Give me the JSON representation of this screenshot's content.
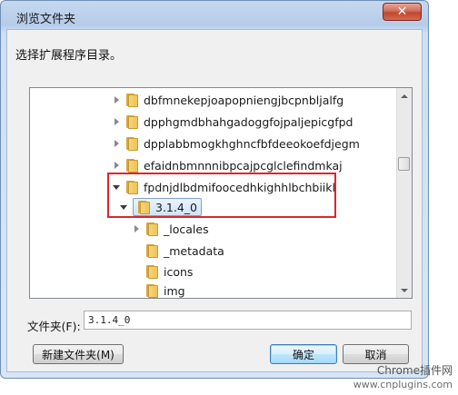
{
  "window": {
    "title": "浏览文件夹"
  },
  "prompt": "选择扩展程序目录。",
  "tree": {
    "items": [
      {
        "label": "dbfmnekepjoapopniengjbcpnbljalfg",
        "state": "collapsed"
      },
      {
        "label": "dpphgmdbhahgadoggfojpaljepicgfpd",
        "state": "collapsed"
      },
      {
        "label": "dpplabbmogkhghncfbfdeeokoefdjegm",
        "state": "collapsed"
      },
      {
        "label": "efaidnbmnnnibpcajpcglclefindmkaj",
        "state": "collapsed"
      },
      {
        "label": "fpdnjdlbdmifoocedhkighhlbchbiikl",
        "state": "expanded"
      },
      {
        "label": "3.1.4_0",
        "state": "expanded",
        "selected": true
      },
      {
        "label": "_locales",
        "state": "collapsed"
      },
      {
        "label": "_metadata",
        "state": "none"
      },
      {
        "label": "icons",
        "state": "none"
      },
      {
        "label": "img",
        "state": "none"
      }
    ]
  },
  "folder_field": {
    "label": "文件夹(F):",
    "value": "3.1.4_0"
  },
  "buttons": {
    "new_folder": "新建文件夹(M)",
    "ok": "确定",
    "cancel": "取消"
  },
  "watermark": {
    "line1": "Chrome插件网",
    "line2": "www.cnplugins.com"
  },
  "colors": {
    "highlight_box": "#e0252a",
    "selection": "#cfe4fb"
  }
}
